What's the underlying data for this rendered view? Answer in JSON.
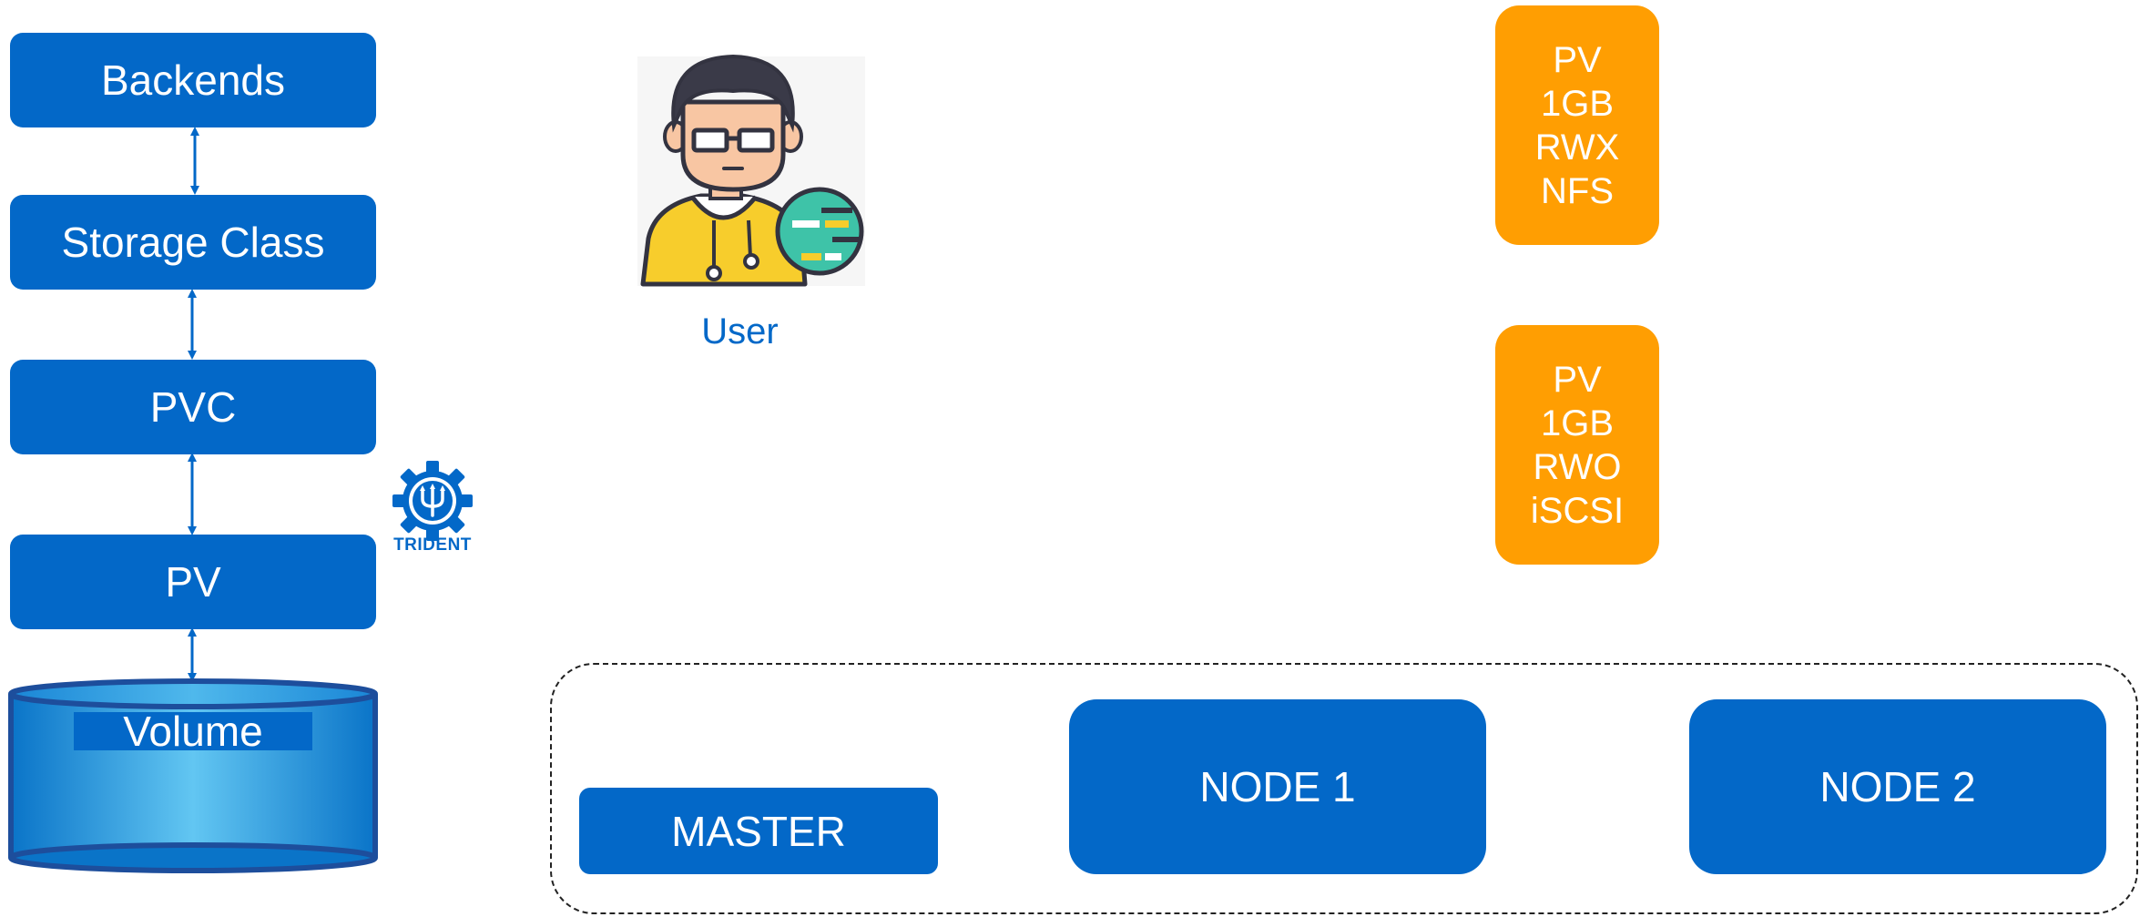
{
  "stack": {
    "backends": "Backends",
    "storage_class": "Storage Class",
    "pvc": "PVC",
    "pv": "PV",
    "volume": "Volume"
  },
  "trident": {
    "label": "TRIDENT",
    "icon": "trident-gear-icon"
  },
  "user": {
    "label": "User",
    "icon": "user-avatar-icon"
  },
  "volumes": [
    {
      "line1": "PV",
      "line2": "1GB",
      "line3": "RWX",
      "line4": "NFS"
    },
    {
      "line1": "PV",
      "line2": "1GB",
      "line3": "RWO",
      "line4": "iSCSI"
    }
  ],
  "cluster": {
    "master": "MASTER",
    "node1": "NODE 1",
    "node2": "NODE 2"
  },
  "colors": {
    "primary_blue": "#0368c8",
    "orange": "#ff9e02",
    "volume_light": "#5bc0f0"
  }
}
